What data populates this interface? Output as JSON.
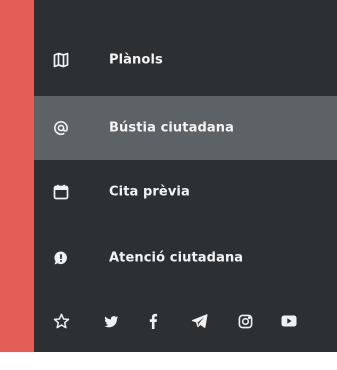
{
  "menu": {
    "items": [
      {
        "label": "Plànols",
        "icon": "map-icon"
      },
      {
        "label": "Bústia ciutadana",
        "icon": "at-sign-icon"
      },
      {
        "label": "Cita prèvia",
        "icon": "calendar-icon"
      },
      {
        "label": "Atenció ciutadana",
        "icon": "chat-bubble-icon"
      }
    ],
    "active_index": 1
  },
  "social_icons": [
    "star-icon",
    "twitter-icon",
    "facebook-icon",
    "telegram-icon",
    "instagram-icon",
    "youtube-icon"
  ],
  "colors": {
    "accent": "#e25d55",
    "panel": "#2d3033",
    "active": "#5d6266",
    "text": "#f3f3f3"
  }
}
